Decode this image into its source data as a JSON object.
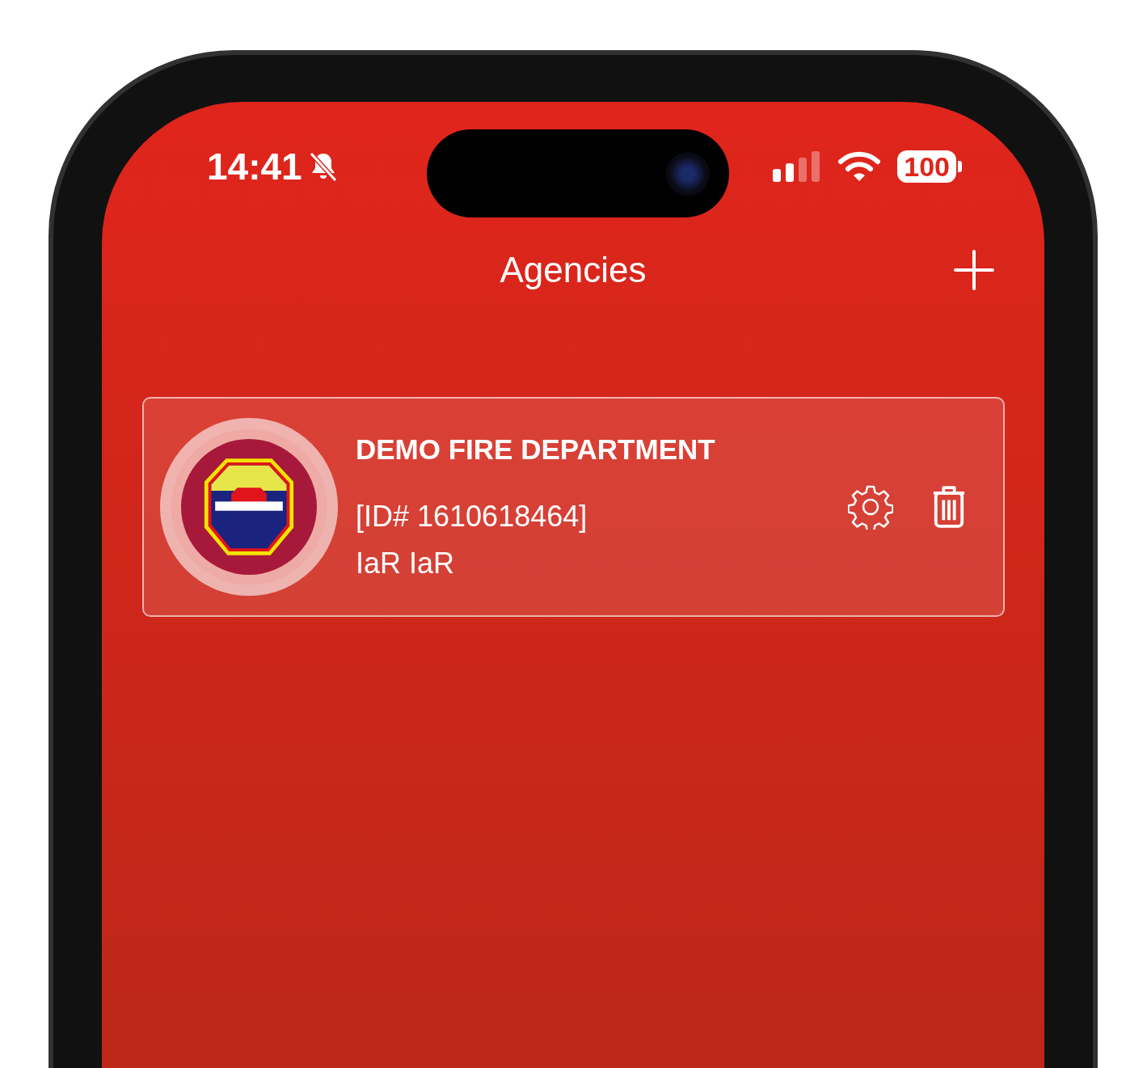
{
  "status_bar": {
    "time": "14:41",
    "battery": "100"
  },
  "header": {
    "title": "Agencies"
  },
  "agencies": [
    {
      "name": "DEMO FIRE DEPARTMENT",
      "id_label": "[ID# 1610618464]",
      "subtitle": "IaR IaR"
    }
  ]
}
